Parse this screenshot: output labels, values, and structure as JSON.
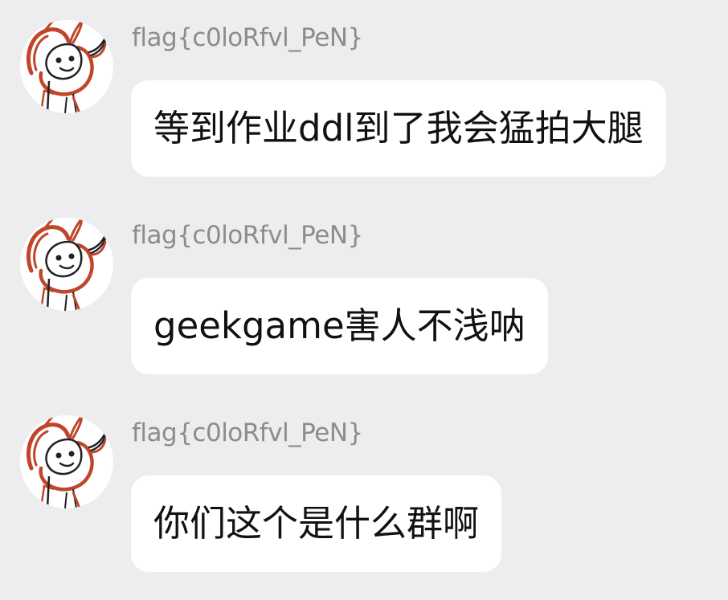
{
  "messages": [
    {
      "sender": "flag{c0loRfvl_PeN}",
      "text": "等到作业ddl到了我会猛拍大腿"
    },
    {
      "sender": "flag{c0loRfvl_PeN}",
      "text": "geekgame害人不浅呐"
    },
    {
      "sender": "flag{c0loRfvl_PeN}",
      "text": "你们这个是什么群啊"
    }
  ],
  "avatar_icon": "sketch-dog-avatar-icon",
  "colors": {
    "background": "#ededf0",
    "bubble": "#ffffff",
    "sender_text": "#8c8c8c",
    "message_text": "#111111",
    "avatar_stroke": "#c0452a"
  }
}
